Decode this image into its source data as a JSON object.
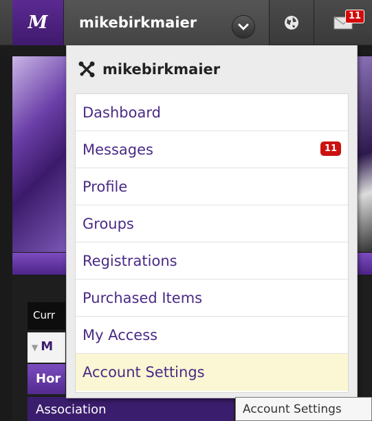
{
  "topbar": {
    "logo_glyph": "M",
    "username": "mikebirkmaier",
    "mail_count": "11"
  },
  "dropdown": {
    "header_title": "mikebirkmaier",
    "items": [
      {
        "label": "Dashboard"
      },
      {
        "label": "Messages",
        "badge": "11"
      },
      {
        "label": "Profile"
      },
      {
        "label": "Groups"
      },
      {
        "label": "Registrations"
      },
      {
        "label": "Purchased Items"
      },
      {
        "label": "My Access"
      },
      {
        "label": "Account Settings",
        "highlighted": true
      }
    ]
  },
  "background": {
    "curr_label": "Curr",
    "m_label": "M",
    "home_label": "Hor",
    "association_label": "Association"
  },
  "tooltip": {
    "text": "Account Settings"
  },
  "colors": {
    "accent_purple": "#4a2a86",
    "badge_red": "#cc1111",
    "highlight": "#fbf6d3"
  }
}
